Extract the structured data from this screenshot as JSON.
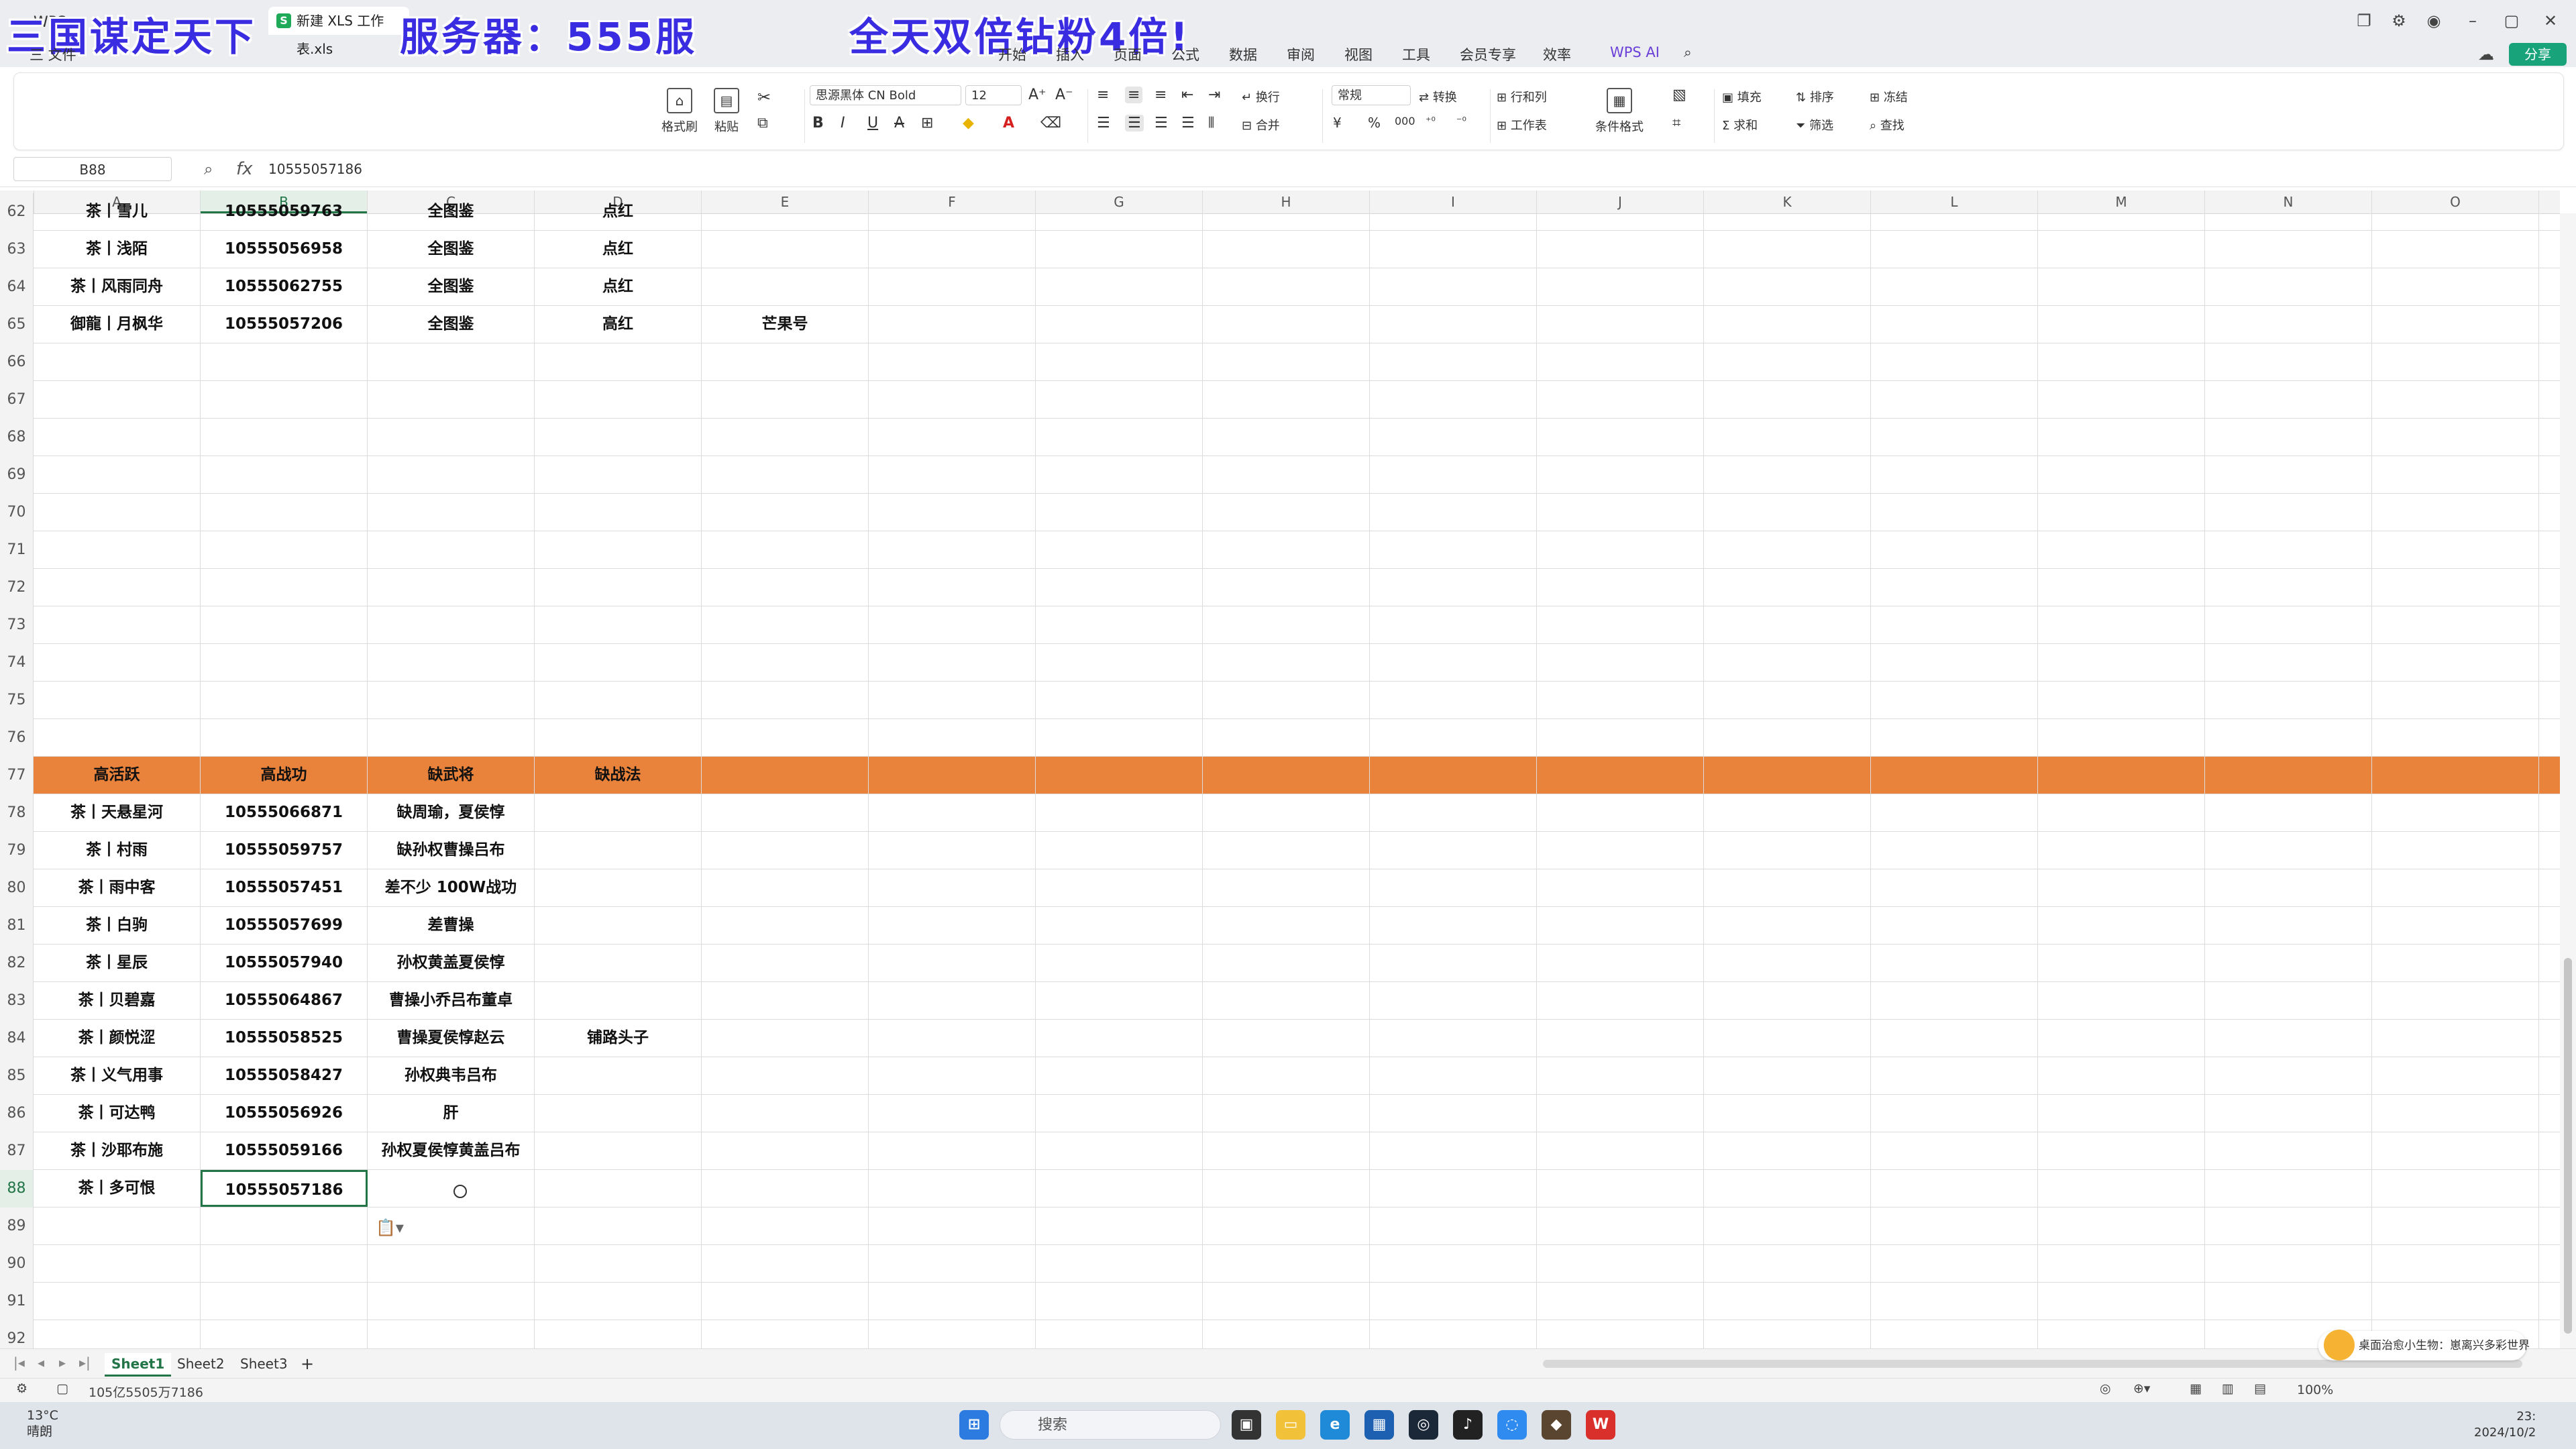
{
  "titlebar": {
    "left_tab": "WPS",
    "file_tab": "新建 XLS 工作表.xls",
    "overlay_left": "三国谋定天下",
    "overlay_mid": "服务器：555服",
    "overlay_right": "全天双倍钻粉4倍!",
    "file_menu": "三 文件",
    "menu_tabs": [
      "开始",
      "插入",
      "页面",
      "公式",
      "数据",
      "审阅",
      "视图",
      "工具",
      "会员专享",
      "效率"
    ],
    "active_tab": "开始",
    "wps_ai": "WPS AI",
    "share": "分享"
  },
  "ribbon": {
    "format_painter": "格式刷",
    "paste": "粘贴",
    "font_name": "思源黑体 CN Bold",
    "font_size": "12",
    "wrap": "换行",
    "merge": "合并",
    "number_format": "常规",
    "convert": "转换",
    "rows_cols": "行和列",
    "worksheet": "工作表",
    "cond_format": "条件格式",
    "fill": "填充",
    "sort": "排序",
    "freeze": "冻结",
    "sum": "求和",
    "filter": "筛选",
    "find": "查找"
  },
  "formula": {
    "name_box": "B88",
    "fx": "fx",
    "value": "10555057186"
  },
  "columns": [
    "A",
    "B",
    "C",
    "D",
    "E",
    "F",
    "G",
    "H",
    "I",
    "J",
    "K",
    "L",
    "M",
    "N",
    "O"
  ],
  "rows": [
    {
      "n": "62",
      "cells": [
        "茶丨雪儿",
        "10555059763",
        "全图鉴",
        "点红",
        ""
      ]
    },
    {
      "n": "63",
      "cells": [
        "茶丨浅陌",
        "10555056958",
        "全图鉴",
        "点红",
        ""
      ]
    },
    {
      "n": "64",
      "cells": [
        "茶丨风雨同舟",
        "10555062755",
        "全图鉴",
        "点红",
        ""
      ]
    },
    {
      "n": "65",
      "cells": [
        "御龍丨月枫华",
        "10555057206",
        "全图鉴",
        "高红",
        "芒果号"
      ]
    },
    {
      "n": "66",
      "cells": [
        "",
        "",
        "",
        "",
        ""
      ]
    },
    {
      "n": "67",
      "cells": [
        "",
        "",
        "",
        "",
        ""
      ]
    },
    {
      "n": "68",
      "cells": [
        "",
        "",
        "",
        "",
        ""
      ]
    },
    {
      "n": "69",
      "cells": [
        "",
        "",
        "",
        "",
        ""
      ]
    },
    {
      "n": "70",
      "cells": [
        "",
        "",
        "",
        "",
        ""
      ]
    },
    {
      "n": "71",
      "cells": [
        "",
        "",
        "",
        "",
        ""
      ]
    },
    {
      "n": "72",
      "cells": [
        "",
        "",
        "",
        "",
        ""
      ]
    },
    {
      "n": "73",
      "cells": [
        "",
        "",
        "",
        "",
        ""
      ]
    },
    {
      "n": "74",
      "cells": [
        "",
        "",
        "",
        "",
        ""
      ]
    },
    {
      "n": "75",
      "cells": [
        "",
        "",
        "",
        "",
        ""
      ]
    },
    {
      "n": "76",
      "cells": [
        "",
        "",
        "",
        "",
        ""
      ]
    },
    {
      "n": "77",
      "cells": [
        "高活跃",
        "高战功",
        "缺武将",
        "缺战法",
        ""
      ],
      "header": true
    },
    {
      "n": "78",
      "cells": [
        "茶丨天悬星河",
        "10555066871",
        "缺周瑜，夏侯惇",
        "",
        ""
      ]
    },
    {
      "n": "79",
      "cells": [
        "茶丨村雨",
        "10555059757",
        "缺孙权曹操吕布",
        "",
        ""
      ]
    },
    {
      "n": "80",
      "cells": [
        "茶丨雨中客",
        "10555057451",
        "差不少 100W战功",
        "",
        ""
      ]
    },
    {
      "n": "81",
      "cells": [
        "茶丨白驹",
        "10555057699",
        "差曹操",
        "",
        ""
      ]
    },
    {
      "n": "82",
      "cells": [
        "茶丨星辰",
        "10555057940",
        "孙权黄盖夏侯惇",
        "",
        ""
      ]
    },
    {
      "n": "83",
      "cells": [
        "茶丨贝碧嘉",
        "10555064867",
        "曹操小乔吕布董卓",
        "",
        ""
      ]
    },
    {
      "n": "84",
      "cells": [
        "茶丨颜悦涩",
        "10555058525",
        "曹操夏侯惇赵云",
        "铺路头子",
        ""
      ]
    },
    {
      "n": "85",
      "cells": [
        "茶丨义气用事",
        "10555058427",
        "孙权典韦吕布",
        "",
        ""
      ]
    },
    {
      "n": "86",
      "cells": [
        "茶丨可达鸭",
        "10555056926",
        "肝",
        "",
        ""
      ]
    },
    {
      "n": "87",
      "cells": [
        "茶丨沙耶布施",
        "10555059166",
        "孙权夏侯惇黄盖吕布",
        "",
        ""
      ]
    },
    {
      "n": "88",
      "cells": [
        "茶丨多可恨",
        "10555057186",
        "",
        "",
        ""
      ],
      "selected": true
    },
    {
      "n": "89",
      "cells": [
        "",
        "",
        "",
        "",
        ""
      ]
    },
    {
      "n": "90",
      "cells": [
        "",
        "",
        "",
        "",
        ""
      ]
    },
    {
      "n": "91",
      "cells": [
        "",
        "",
        "",
        "",
        ""
      ]
    },
    {
      "n": "92",
      "cells": [
        "",
        "",
        "",
        "",
        ""
      ]
    }
  ],
  "sheets": [
    "Sheet1",
    "Sheet2",
    "Sheet3"
  ],
  "active_sheet": "Sheet1",
  "status": {
    "sum_text": "105亿5505万7186",
    "zoom": "100%"
  },
  "notification": "桌面治愈小生物：崽离兴多彩世界",
  "taskbar": {
    "weather_temp": "13°C",
    "weather_desc": "晴朗",
    "search_placeholder": "搜索",
    "time": "23:",
    "date": "2024/10/2"
  },
  "colors": {
    "header_row": "#e9823a",
    "selection": "#227547",
    "accent": "#1a6fe0",
    "overlay_text": "#3a2ce0"
  }
}
